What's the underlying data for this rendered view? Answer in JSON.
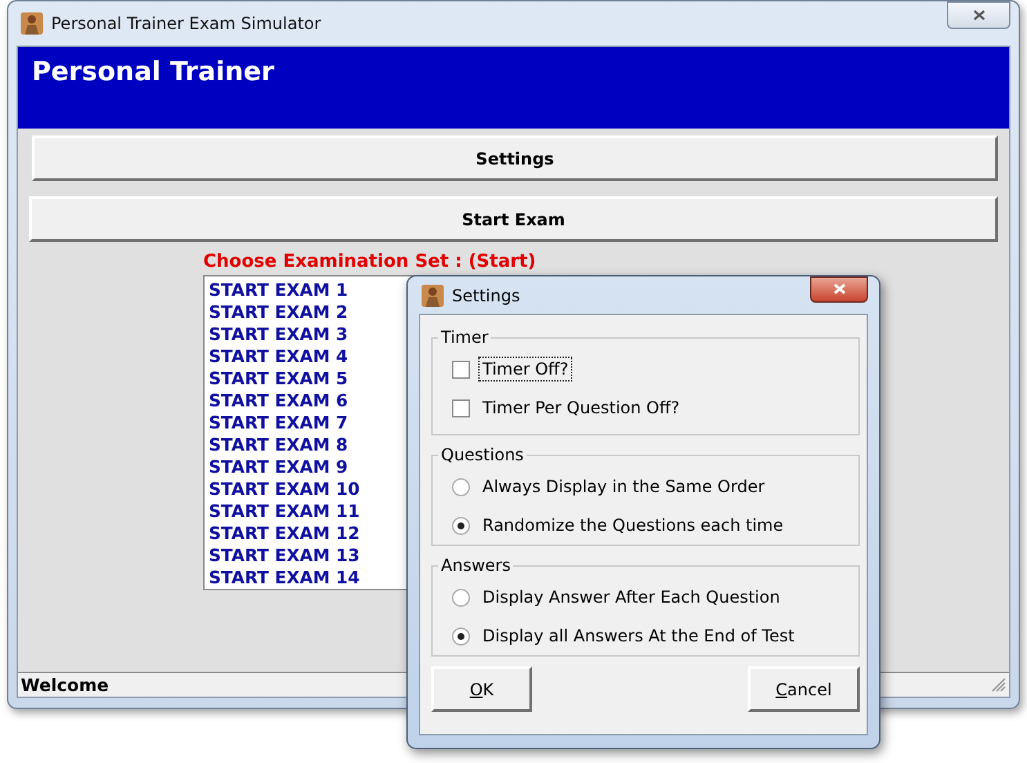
{
  "window": {
    "title": "Personal Trainer Exam Simulator"
  },
  "header": {
    "title": "Personal Trainer"
  },
  "buttons": [
    {
      "label": "Settings"
    },
    {
      "label": "Start Exam"
    }
  ],
  "exam_set": {
    "label": "Choose Examination Set : (Start)",
    "items": [
      "START EXAM 1",
      "START EXAM 2",
      "START EXAM 3",
      "START EXAM 4",
      "START EXAM 5",
      "START EXAM 6",
      "START EXAM 7",
      "START EXAM 8",
      "START EXAM 9",
      "START EXAM 10",
      "START EXAM 11",
      "START EXAM 12",
      "START EXAM 13",
      "START EXAM 14"
    ]
  },
  "status_bar": {
    "text": "Welcome"
  },
  "dialog": {
    "title": "Settings",
    "groups": [
      {
        "title": "Timer",
        "options": [
          {
            "kind": "checkbox",
            "label": "Timer Off?",
            "checked": false,
            "focused": true
          },
          {
            "kind": "checkbox",
            "label": "Timer Per Question Off?",
            "checked": false,
            "focused": false
          }
        ]
      },
      {
        "title": "Questions",
        "options": [
          {
            "kind": "radio",
            "label": "Always Display in the Same Order",
            "selected": false,
            "focused": false
          },
          {
            "kind": "radio",
            "label": "Randomize the Questions each time",
            "selected": true,
            "focused": false
          }
        ]
      },
      {
        "title": "Answers",
        "options": [
          {
            "kind": "radio",
            "label": "Display Answer After Each Question",
            "selected": false,
            "focused": false
          },
          {
            "kind": "radio",
            "label": "Display all Answers At the End of Test",
            "selected": true,
            "focused": false
          }
        ]
      }
    ],
    "buttons": [
      {
        "label": "OK"
      },
      {
        "label": "Cancel"
      }
    ]
  }
}
